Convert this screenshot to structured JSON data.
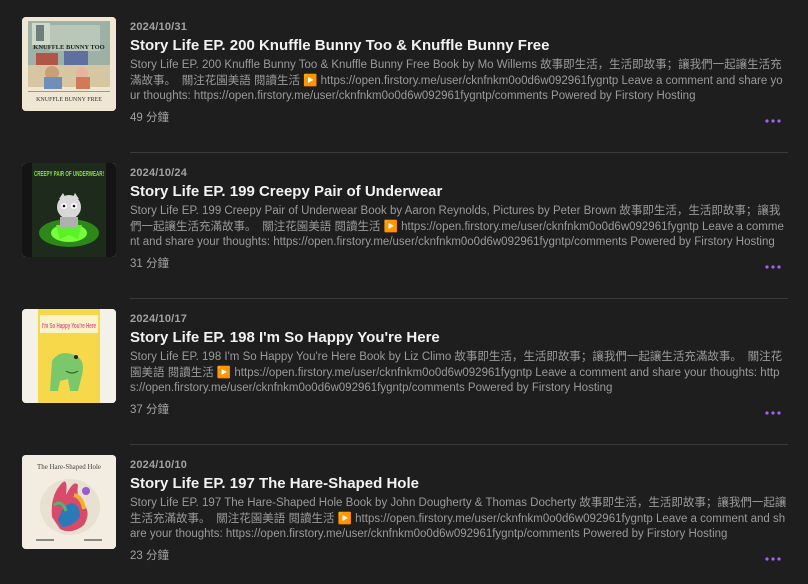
{
  "episodes": [
    {
      "date": "2024/10/31",
      "title": "Story Life EP. 200 Knuffle Bunny Too & Knuffle Bunny Free",
      "description": "Story Life EP. 200 Knuffle Bunny Too & Knuffle Bunny Free Book by Mo Willems 故事即生活，生活即故事；讓我們一起讓生活充滿故事。　關注花園美語 閱讀生活 ▶️ https://open.firstory.me/user/cknfnkm0o0d6w092961fygntp Leave a comment and share your thoughts: https://open.firstory.me/user/cknfnkm0o0d6w092961fygntp/comments Powered by Firstory Hosting",
      "duration": "49 分鐘",
      "cover": {
        "top_text": "KNUFFLE BUNNY TOO",
        "bottom_text": "KNUFFLE BUNNY FREE",
        "icon": "knuffle-bunny-cover"
      }
    },
    {
      "date": "2024/10/24",
      "title": "Story Life EP. 199 Creepy Pair of Underwear",
      "description": "Story Life EP. 199 Creepy Pair of Underwear Book by Aaron Reynolds, Pictures by Peter Brown 故事即生活，生活即故事；讓我們一起讓生活充滿故事。　關注花園美語 閱讀生活 ▶️ https://open.firstory.me/user/cknfnkm0o0d6w092961fygntp Leave a comment and share your thoughts: https://open.firstory.me/user/cknfnkm0o0d6w092961fygntp/comments Powered by Firstory Hosting",
      "duration": "31 分鐘",
      "cover": {
        "top_text": "CREEPY PAIR OF UNDERWEAR!",
        "icon": "creepy-underwear-cover"
      }
    },
    {
      "date": "2024/10/17",
      "title": "Story Life EP. 198 I'm So Happy You're Here",
      "description": "Story Life EP. 198 I'm So Happy You're Here Book by Liz Climo 故事即生活，生活即故事；讓我們一起讓生活充滿故事。　關注花園美語 閱讀生活 ▶️ https://open.firstory.me/user/cknfnkm0o0d6w092961fygntp Leave a comment and share your thoughts: https://open.firstory.me/user/cknfnkm0o0d6w092961fygntp/comments Powered by Firstory Hosting",
      "duration": "37 分鐘",
      "cover": {
        "top_text": "I'm So Happy You're Here",
        "icon": "so-happy-cover"
      }
    },
    {
      "date": "2024/10/10",
      "title": "Story Life EP. 197 The Hare-Shaped Hole",
      "description": "Story Life EP. 197 The Hare-Shaped Hole Book by John Dougherty & Thomas Docherty 故事即生活，生活即故事；讓我們一起讓生活充滿故事。　關注花園美語 閱讀生活 ▶️ https://open.firstory.me/user/cknfnkm0o0d6w092961fygntp Leave a comment and share your thoughts: https://open.firstory.me/user/cknfnkm0o0d6w092961fygntp/comments Powered by Firstory Hosting",
      "duration": "23 分鐘",
      "cover": {
        "top_text": "The Hare-Shaped Hole",
        "icon": "hare-shaped-hole-cover"
      }
    }
  ],
  "colors": {
    "background": "#1e1e1e",
    "accent": "#a463f2",
    "title": "#f2f2f2",
    "secondary": "#9a9a9a",
    "divider": "#3a3a3a"
  },
  "icons": {
    "more": "more-horizontal-icon"
  }
}
